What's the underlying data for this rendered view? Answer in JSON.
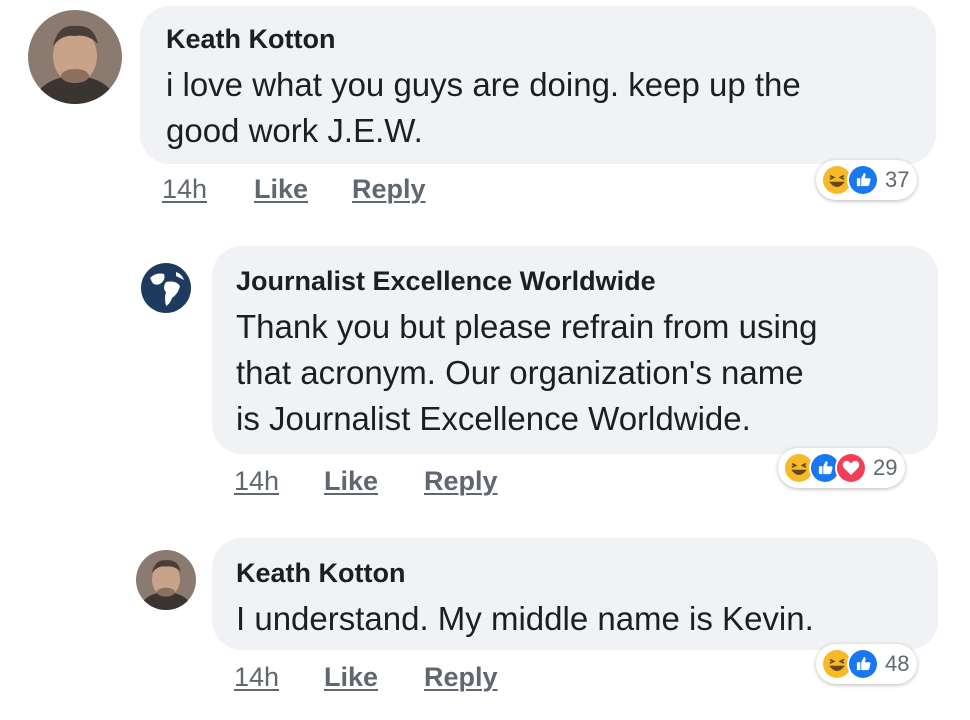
{
  "comments": [
    {
      "author": "Keath Kotton",
      "text_lines": [
        "i love what you guys are doing.  keep up the",
        "good work J.E.W."
      ],
      "time": "14h",
      "like_label": "Like",
      "reply_label": "Reply",
      "reactions": [
        "haha-icon",
        "like-icon"
      ],
      "reaction_count": "37"
    },
    {
      "author": "Journalist Excellence Worldwide",
      "text_lines": [
        "Thank you but please refrain from using",
        "that acronym. Our organization's name",
        "is Journalist Excellence Worldwide."
      ],
      "time": "14h",
      "like_label": "Like",
      "reply_label": "Reply",
      "reactions": [
        "haha-icon",
        "like-icon",
        "love-icon"
      ],
      "reaction_count": "29"
    },
    {
      "author": "Keath Kotton",
      "text_lines": [
        "I understand.  My middle name is Kevin."
      ],
      "time": "14h",
      "like_label": "Like",
      "reply_label": "Reply",
      "reactions": [
        "haha-icon",
        "like-icon"
      ],
      "reaction_count": "48"
    }
  ],
  "colors": {
    "bubble": "#f0f2f5",
    "like_blue": "#1877f2",
    "love_red": "#f33e58",
    "haha_yellow": "#f7b928",
    "meta_gray": "#606770",
    "globe_navy": "#1e3a5f"
  }
}
